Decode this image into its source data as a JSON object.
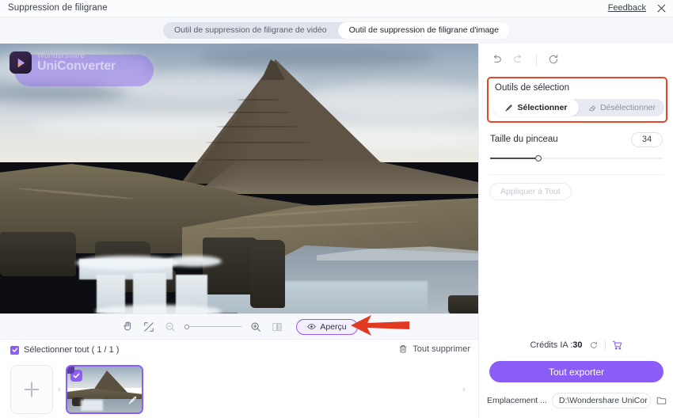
{
  "titlebar": {
    "title": "Suppression de filigrane",
    "feedback": "Feedback",
    "close_icon": "close-icon"
  },
  "tabs": [
    {
      "label": "Outil de suppression de filigrane de vidéo",
      "active": false
    },
    {
      "label": "Outil de suppression de filigrane d'image",
      "active": true
    }
  ],
  "canvas": {
    "watermark": {
      "brand_top": "Wondershare",
      "brand_bottom": "UniConverter"
    },
    "toolbar": {
      "hand_icon": "hand-icon",
      "fit_icon": "fit-screen-icon",
      "zoom_out_icon": "zoom-out-icon",
      "zoom_in_icon": "zoom-in-icon",
      "compare_icon": "split-compare-icon",
      "zoom_value": "0",
      "preview_label": "Aperçu",
      "preview_icon": "eye-icon"
    },
    "annotation": {
      "type": "red-arrow",
      "color": "#e03a20"
    }
  },
  "filmstrip": {
    "select_all_label": "Sélectionner tout ( 1 / 1 )",
    "select_all_checked": true,
    "delete_all_label": "Tout supprimer",
    "delete_all_icon": "trash-icon",
    "add_icon": "plus-icon",
    "prev_arrow": "‹",
    "next_arrow": "›",
    "items": [
      {
        "selected": true,
        "edit_icon": "brush-icon"
      }
    ]
  },
  "right_panel": {
    "history": {
      "undo_icon": "undo-icon",
      "redo_icon": "redo-icon",
      "reset_icon": "reset-icon"
    },
    "selection_tools": {
      "title": "Outils de sélection",
      "highlight_color": "#e2482a",
      "options": [
        {
          "label": "Sélectionner",
          "icon": "brush-icon",
          "active": true
        },
        {
          "label": "Désélectionner",
          "icon": "eraser-icon",
          "active": false
        }
      ]
    },
    "brush": {
      "label": "Taille du pinceau",
      "value": "34",
      "slider_percent": 28
    },
    "apply_all": {
      "label": "Appliquer à Tout",
      "disabled": true
    },
    "credits": {
      "label": "Crédits IA :",
      "value": "30",
      "refresh_icon": "refresh-icon",
      "cart_icon": "cart-icon"
    },
    "export": {
      "label": "Tout exporter",
      "color": "#8b5cf6"
    },
    "location": {
      "label": "Emplacement ...",
      "path": "D:\\Wondershare UniCor",
      "caret_icon": "chevron-down-icon",
      "folder_icon": "folder-icon"
    }
  }
}
